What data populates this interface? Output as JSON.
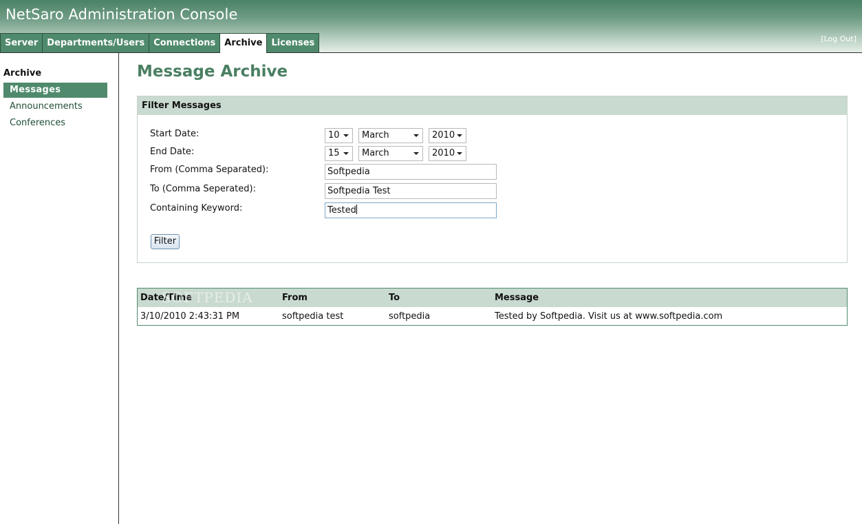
{
  "app": {
    "title": "NetSaro Administration Console",
    "logout": "[Log Out]"
  },
  "tabs": [
    "Server",
    "Departments/Users",
    "Connections",
    "Archive",
    "Licenses"
  ],
  "active_tab": "Archive",
  "sidebar": {
    "title": "Archive",
    "items": [
      "Messages",
      "Announcements",
      "Conferences"
    ],
    "active": "Messages"
  },
  "page_title": "Message Archive",
  "filter": {
    "header": "Filter Messages",
    "labels": {
      "start_date": "Start Date:",
      "end_date": "End Date:",
      "from": "From (Comma Separated):",
      "to": "To (Comma Seperated):",
      "keyword": "Containing Keyword:"
    },
    "start": {
      "day": "10",
      "month": "March",
      "year": "2010"
    },
    "end": {
      "day": "15",
      "month": "March",
      "year": "2010"
    },
    "from_value": "Softpedia",
    "to_value": "Softpedia Test",
    "keyword_value": "Tested",
    "button": "Filter"
  },
  "results": {
    "headers": [
      "Date/Time",
      "From",
      "To",
      "Message"
    ],
    "rows": [
      [
        "3/10/2010 2:43:31 PM",
        "softpedia test",
        "softpedia",
        "Tested by Softpedia. Visit us at www.softpedia.com"
      ]
    ]
  },
  "watermark": "SOFTPEDIA"
}
